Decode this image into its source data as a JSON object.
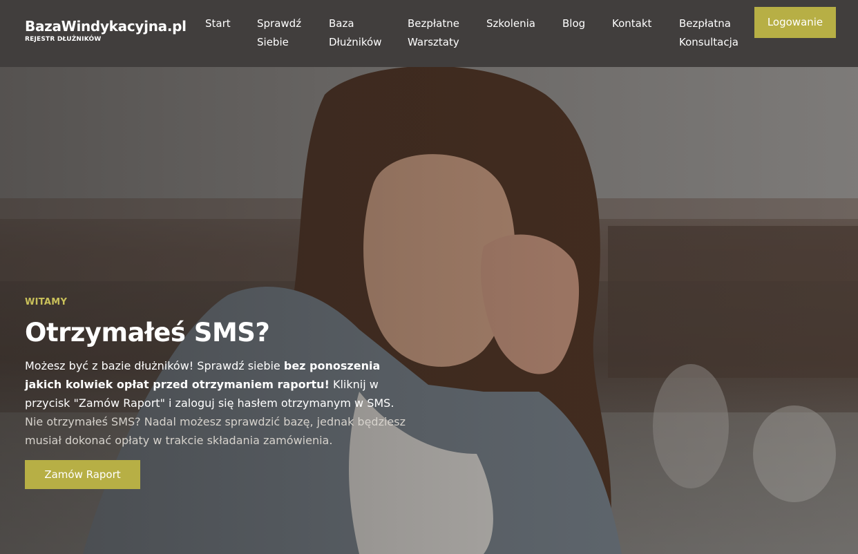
{
  "brand": {
    "name": "BazaWindykacyjna.pl",
    "tagline": "REJESTR DŁUŻNIKÓW"
  },
  "nav": {
    "items": [
      {
        "label_line1": "Start",
        "label_line2": ""
      },
      {
        "label_line1": "Sprawdź",
        "label_line2": "Siebie"
      },
      {
        "label_line1": "Baza",
        "label_line2": "Dłużników"
      },
      {
        "label_line1": "Bezpłatne",
        "label_line2": "Warsztaty"
      },
      {
        "label_line1": "Szkolenia",
        "label_line2": ""
      },
      {
        "label_line1": "Blog",
        "label_line2": ""
      },
      {
        "label_line1": "Kontakt",
        "label_line2": ""
      },
      {
        "label_line1": "Bezpłatna",
        "label_line2": "Konsultacja"
      }
    ],
    "login_label": "Logowanie"
  },
  "hero": {
    "eyebrow": "WITAMY",
    "headline": "Otrzymałeś SMS?",
    "lead_part1": "Możesz być z bazie dłużników! Sprawdź siebie ",
    "lead_bold": "bez ponoszenia jakich kolwiek opłat przed otrzymaniem raportu!",
    "lead_part2": " Kliknij w przycisk \"Zamów Raport\" i zaloguj się hasłem otrzymanym w SMS.",
    "sub": "Nie otrzymałeś SMS? Nadal możesz sprawdzić bazę, jednak będziesz musiał dokonać opłaty w trakcie składania zamówienia.",
    "cta_label": "Zamów Raport"
  },
  "colors": {
    "header_bg": "#413e3d",
    "accent": "#b7af45",
    "eyebrow": "#c9c05a"
  }
}
